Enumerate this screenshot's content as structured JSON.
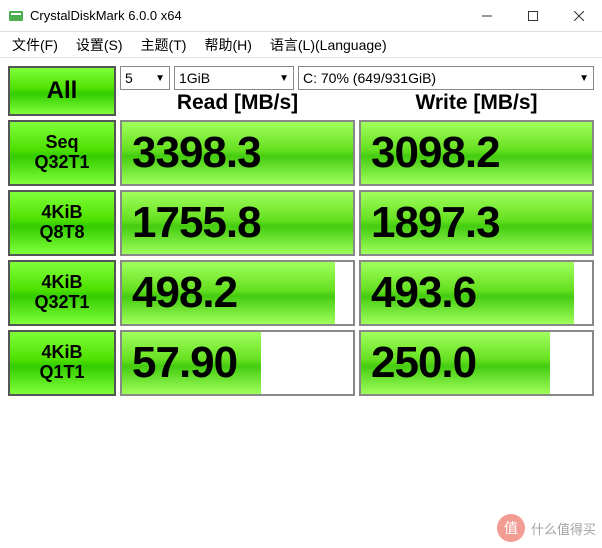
{
  "window": {
    "title": "CrystalDiskMark 6.0.0 x64"
  },
  "menu": {
    "file": "文件(F)",
    "settings": "设置(S)",
    "theme": "主题(T)",
    "help": "帮助(H)",
    "language": "语言(L)(Language)"
  },
  "controls": {
    "all_label": "All",
    "count": "5",
    "size": "1GiB",
    "drive": "C: 70% (649/931GiB)"
  },
  "headers": {
    "read": "Read [MB/s]",
    "write": "Write [MB/s]"
  },
  "tests": [
    {
      "label1": "Seq",
      "label2": "Q32T1",
      "read": "3398.3",
      "write": "3098.2",
      "rfill": "100%",
      "wfill": "100%"
    },
    {
      "label1": "4KiB",
      "label2": "Q8T8",
      "read": "1755.8",
      "write": "1897.3",
      "rfill": "100%",
      "wfill": "100%"
    },
    {
      "label1": "4KiB",
      "label2": "Q32T1",
      "read": "498.2",
      "write": "493.6",
      "rfill": "92%",
      "wfill": "92%"
    },
    {
      "label1": "4KiB",
      "label2": "Q1T1",
      "read": "57.90",
      "write": "250.0",
      "rfill": "60%",
      "wfill": "82%"
    }
  ],
  "watermark": "什么值得买"
}
